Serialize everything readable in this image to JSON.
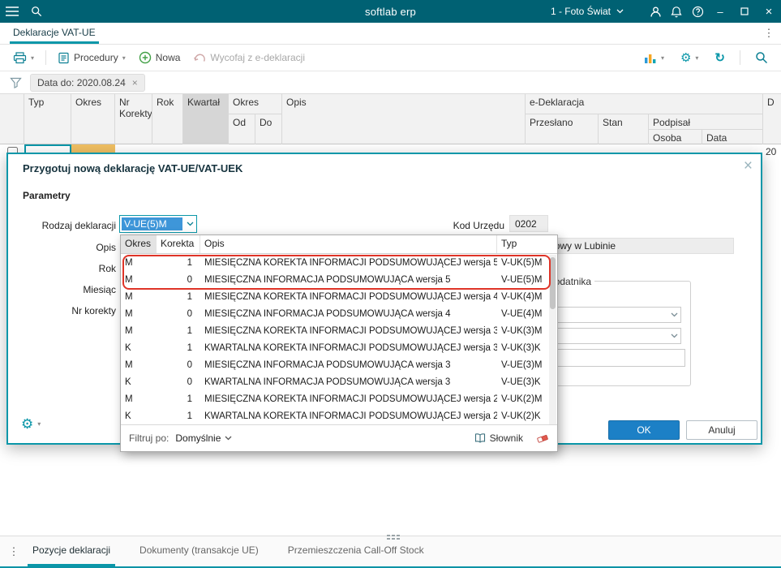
{
  "topbar": {
    "title": "softlab erp",
    "company": "1 - Foto Świat"
  },
  "tabbar": {
    "tab": "Deklaracje VAT-UE"
  },
  "toolbar": {
    "procedury": "Procedury",
    "nowa": "Nowa",
    "wycofaj": "Wycofaj z e-deklaracji"
  },
  "filter": {
    "chip": "Data do: 2020.08.24"
  },
  "grid": {
    "col_typ": "Typ",
    "col_okres": "Okres",
    "col_nr": "Nr",
    "col_korekty": "Korekty",
    "col_rok": "Rok",
    "col_kwartal": "Kwartał",
    "col_okres2": "Okres",
    "col_od": "Od",
    "col_do": "Do",
    "col_opis": "Opis",
    "col_edeklaracja": "e-Deklaracja",
    "col_przeslano": "Przesłano",
    "col_stan": "Stan",
    "col_podpisal": "Podpisał",
    "col_osoba": "Osoba",
    "col_data": "Data",
    "col_partial": "D",
    "row_partial_value": "20"
  },
  "dialog": {
    "title": "Przygotuj nową deklarację VAT-UE/VAT-UEK",
    "section": "Parametry",
    "rodzaj_label": "Rodzaj deklaracji",
    "rodzaj_value": "V-UE(5)M",
    "kod_label": "Kod Urzędu",
    "kod_value": "0202",
    "opis_label": "Opis",
    "urzad_value": "Urząd Skarbowy w Lubinie",
    "rok_label": "Rok",
    "miesiac_label": "Miesiąc",
    "nr_korekty_label": "Nr korekty",
    "group_label": "Dane podatnika",
    "ok": "OK",
    "cancel": "Anuluj"
  },
  "picker": {
    "headers": [
      "Okres",
      "Korekta",
      "Opis",
      "Typ"
    ],
    "rows": [
      {
        "okres": "M",
        "korekta": "1",
        "opis": "MIESIĘCZNA KOREKTA INFORMACJI PODSUMOWUJĄCEJ wersja 5",
        "typ": "V-UK(5)M"
      },
      {
        "okres": "M",
        "korekta": "0",
        "opis": "MIESIĘCZNA INFORMACJA PODSUMOWUJĄCA wersja 5",
        "typ": "V-UE(5)M"
      },
      {
        "okres": "M",
        "korekta": "1",
        "opis": "MIESIĘCZNA KOREKTA INFORMACJI PODSUMOWUJĄCEJ wersja 4",
        "typ": "V-UK(4)M"
      },
      {
        "okres": "M",
        "korekta": "0",
        "opis": "MIESIĘCZNA INFORMACJA PODSUMOWUJĄCA wersja 4",
        "typ": "V-UE(4)M"
      },
      {
        "okres": "M",
        "korekta": "1",
        "opis": "MIESIĘCZNA KOREKTA INFORMACJI PODSUMOWUJĄCEJ wersja 3",
        "typ": "V-UK(3)M"
      },
      {
        "okres": "K",
        "korekta": "1",
        "opis": "KWARTALNA KOREKTA INFORMACJI PODSUMOWUJĄCEJ wersja 3",
        "typ": "V-UK(3)K"
      },
      {
        "okres": "M",
        "korekta": "0",
        "opis": "MIESIĘCZNA INFORMACJA PODSUMOWUJĄCA wersja 3",
        "typ": "V-UE(3)M"
      },
      {
        "okres": "K",
        "korekta": "0",
        "opis": "KWARTALNA INFORMACJA PODSUMOWUJĄCA wersja 3",
        "typ": "V-UE(3)K"
      },
      {
        "okres": "M",
        "korekta": "1",
        "opis": "MIESIĘCZNA KOREKTA INFORMACJI PODSUMOWUJĄCEJ wersja 2",
        "typ": "V-UK(2)M"
      },
      {
        "okres": "K",
        "korekta": "1",
        "opis": "KWARTALNA KOREKTA INFORMACJI PODSUMOWUJĄCEJ wersja 2",
        "typ": "V-UK(2)K"
      }
    ],
    "filter_label": "Filtruj po:",
    "filter_value": "Domyślnie",
    "dictionary": "Słownik"
  },
  "bottom": {
    "tabs": [
      "Pozycje deklaracji",
      "Dokumenty (transakcje UE)",
      "Przemieszczenia Call-Off Stock"
    ]
  },
  "icons": {
    "minimize": "–",
    "close": "×",
    "kebab": "⋮",
    "gear": "⚙",
    "refresh": "↻",
    "chevron": "▾"
  },
  "colors": {
    "topbar-bg": "#006173",
    "accent": "#0b97a9",
    "ok-blue": "#1c80c6",
    "annotation-red": "#df3428",
    "selection-blue": "#3e96d9",
    "warning-cell": "#f0bf62"
  }
}
